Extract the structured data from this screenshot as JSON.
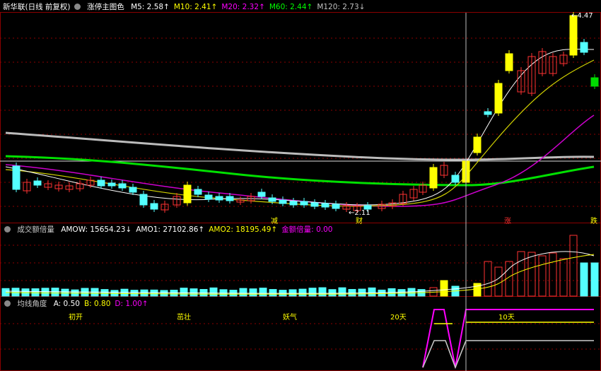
{
  "main": {
    "stock_name": "新华联",
    "period": "(日线 前复权)",
    "indicator_name": "涨停主图色",
    "ma": [
      {
        "label": "M5:",
        "value": "2.58",
        "arrow": "↑",
        "color": "#ffffff"
      },
      {
        "label": "M10:",
        "value": "2.41",
        "arrow": "↑",
        "color": "#ffff00"
      },
      {
        "label": "M20:",
        "value": "2.32",
        "arrow": "↑",
        "color": "#ff00ff"
      },
      {
        "label": "M60:",
        "value": "2.44",
        "arrow": "↑",
        "color": "#00ff00"
      },
      {
        "label": "M120:",
        "value": "2.73",
        "arrow": "↓",
        "color": "#c0c0c0"
      }
    ],
    "high_label": "4.47",
    "low_label": "2.11",
    "markers": [
      {
        "text": "减",
        "color": "#ffff00"
      },
      {
        "text": "财",
        "color": "#ffff00"
      },
      {
        "text": "涨",
        "color": "#ff3030"
      },
      {
        "text": "跌",
        "color": "#ffff00"
      }
    ]
  },
  "volume": {
    "indicator_name": "成交额倍量",
    "items": [
      {
        "label": "AMOW:",
        "value": "15654.23",
        "arrow": "↓",
        "color": "#ffffff"
      },
      {
        "label": "AMO1:",
        "value": "27102.86",
        "arrow": "↑",
        "color": "#ffffff"
      },
      {
        "label": "AMO2:",
        "value": "18195.49",
        "arrow": "↑",
        "color": "#ffff00"
      },
      {
        "label": "金额倍量:",
        "value": "0.00",
        "arrow": "",
        "color": "#ff00ff"
      }
    ]
  },
  "angle": {
    "indicator_name": "均线角度",
    "items": [
      {
        "label": "A:",
        "value": "0.50",
        "color": "#ffffff"
      },
      {
        "label": "B:",
        "value": "0.80",
        "color": "#ffff00"
      },
      {
        "label": "D:",
        "value": "1.00",
        "arrow": "↑",
        "color": "#ff00ff"
      }
    ],
    "labels": [
      "初开",
      "茁壮",
      "妖气",
      "20天",
      "10天"
    ]
  },
  "colors": {
    "up": "#ff3232",
    "down": "#54ffff",
    "limit": "#ffff00",
    "grid": "#8b0000"
  }
}
